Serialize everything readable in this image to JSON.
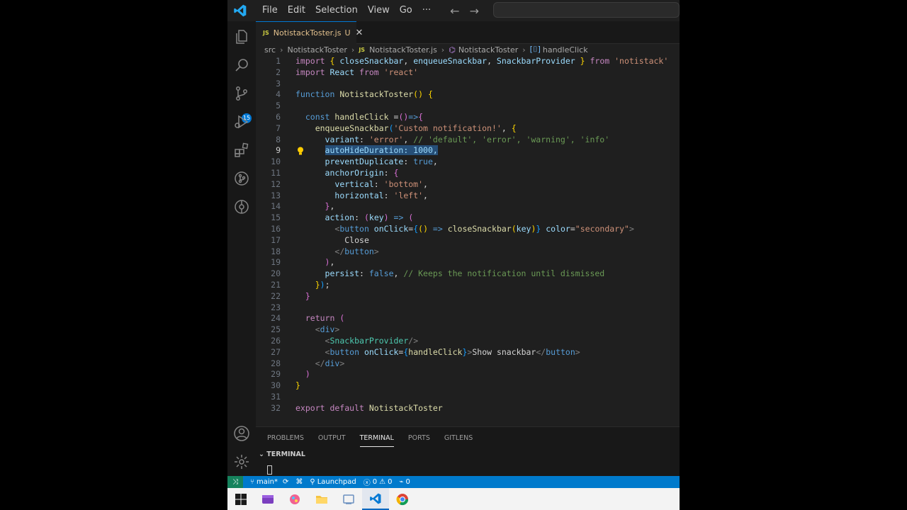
{
  "menu": [
    "File",
    "Edit",
    "Selection",
    "View",
    "Go",
    "···"
  ],
  "tab": {
    "filename": "NotistackToster.js",
    "status": "U",
    "lang_badge": "JS"
  },
  "breadcrumb": [
    "src",
    "NotistackToster",
    "NotistackToster.js",
    "NotistackToster",
    "handleClick"
  ],
  "activity": {
    "scm_badge": "15"
  },
  "editor": {
    "active_line": 9,
    "lines": [
      {
        "n": "1"
      },
      {
        "n": "2"
      },
      {
        "n": "3"
      },
      {
        "n": "4"
      },
      {
        "n": "5"
      },
      {
        "n": "6"
      },
      {
        "n": "7"
      },
      {
        "n": "8"
      },
      {
        "n": "9"
      },
      {
        "n": "10"
      },
      {
        "n": "11"
      },
      {
        "n": "12"
      },
      {
        "n": "13"
      },
      {
        "n": "14"
      },
      {
        "n": "15"
      },
      {
        "n": "16"
      },
      {
        "n": "17"
      },
      {
        "n": "18"
      },
      {
        "n": "19"
      },
      {
        "n": "20"
      },
      {
        "n": "21"
      },
      {
        "n": "22"
      },
      {
        "n": "23"
      },
      {
        "n": "24"
      },
      {
        "n": "25"
      },
      {
        "n": "26"
      },
      {
        "n": "27"
      },
      {
        "n": "28"
      },
      {
        "n": "29"
      },
      {
        "n": "30"
      },
      {
        "n": "31"
      },
      {
        "n": "32"
      }
    ],
    "code": [
      [
        [
          "kw",
          "import "
        ],
        [
          "b1",
          "{ "
        ],
        [
          "var",
          "closeSnackbar"
        ],
        [
          "pl",
          ", "
        ],
        [
          "var",
          "enqueueSnackbar"
        ],
        [
          "pl",
          ", "
        ],
        [
          "var",
          "SnackbarProvider"
        ],
        [
          "b1",
          " } "
        ],
        [
          "kw",
          "from "
        ],
        [
          "str",
          "'notistack'"
        ]
      ],
      [
        [
          "kw",
          "import "
        ],
        [
          "var",
          "React "
        ],
        [
          "kw",
          "from "
        ],
        [
          "str",
          "'react'"
        ]
      ],
      [],
      [
        [
          "kw2",
          "function "
        ],
        [
          "fn",
          "NotistackToster"
        ],
        [
          "b1",
          "() {"
        ]
      ],
      [],
      [
        [
          "pl",
          "  "
        ],
        [
          "kw2",
          "const "
        ],
        [
          "fn",
          "handleClick "
        ],
        [
          "pl",
          "="
        ],
        [
          "b2",
          "()"
        ],
        [
          "kw2",
          "=>"
        ],
        [
          "b2",
          "{"
        ]
      ],
      [
        [
          "pl",
          "    "
        ],
        [
          "fn",
          "enqueueSnackbar"
        ],
        [
          "b3",
          "("
        ],
        [
          "str",
          "'Custom notification!'"
        ],
        [
          "pl",
          ", "
        ],
        [
          "b1",
          "{"
        ]
      ],
      [
        [
          "pl",
          "      "
        ],
        [
          "var",
          "variant"
        ],
        [
          "pl",
          ": "
        ],
        [
          "str",
          "'error'"
        ],
        [
          "pl",
          ", "
        ],
        [
          "cm",
          "// 'default', 'error', 'warning', 'info'"
        ]
      ],
      [
        [
          "pl",
          "      "
        ],
        [
          "sel",
          "autoHideDuration: 1000,"
        ]
      ],
      [
        [
          "pl",
          "      "
        ],
        [
          "var",
          "preventDuplicate"
        ],
        [
          "pl",
          ": "
        ],
        [
          "kw2",
          "true"
        ],
        [
          "pl",
          ","
        ]
      ],
      [
        [
          "pl",
          "      "
        ],
        [
          "var",
          "anchorOrigin"
        ],
        [
          "pl",
          ": "
        ],
        [
          "b2",
          "{"
        ]
      ],
      [
        [
          "pl",
          "        "
        ],
        [
          "var",
          "vertical"
        ],
        [
          "pl",
          ": "
        ],
        [
          "str",
          "'bottom'"
        ],
        [
          "pl",
          ","
        ]
      ],
      [
        [
          "pl",
          "        "
        ],
        [
          "var",
          "horizontal"
        ],
        [
          "pl",
          ": "
        ],
        [
          "str",
          "'left'"
        ],
        [
          "pl",
          ","
        ]
      ],
      [
        [
          "pl",
          "      "
        ],
        [
          "b2",
          "}"
        ],
        [
          "pl",
          ","
        ]
      ],
      [
        [
          "pl",
          "      "
        ],
        [
          "var",
          "action"
        ],
        [
          "pl",
          ": "
        ],
        [
          "b2",
          "("
        ],
        [
          "var",
          "key"
        ],
        [
          "b2",
          ")"
        ],
        [
          "kw2",
          " => "
        ],
        [
          "b2",
          "("
        ]
      ],
      [
        [
          "pl",
          "        "
        ],
        [
          "tag",
          "<"
        ],
        [
          "tn",
          "button "
        ],
        [
          "var",
          "onClick"
        ],
        [
          "pl",
          "="
        ],
        [
          "b3",
          "{"
        ],
        [
          "b1",
          "() "
        ],
        [
          "kw2",
          "=> "
        ],
        [
          "fn",
          "closeSnackbar"
        ],
        [
          "b1",
          "("
        ],
        [
          "var",
          "key"
        ],
        [
          "b1",
          ")"
        ],
        [
          "b3",
          "}"
        ],
        [
          "var",
          " color"
        ],
        [
          "pl",
          "="
        ],
        [
          "str",
          "\"secondary\""
        ],
        [
          "tag",
          ">"
        ]
      ],
      [
        [
          "pl",
          "          "
        ],
        [
          "pl",
          "Close"
        ]
      ],
      [
        [
          "pl",
          "        "
        ],
        [
          "tag",
          "</"
        ],
        [
          "tn",
          "button"
        ],
        [
          "tag",
          ">"
        ]
      ],
      [
        [
          "pl",
          "      "
        ],
        [
          "b2",
          ")"
        ],
        [
          "pl",
          ","
        ]
      ],
      [
        [
          "pl",
          "      "
        ],
        [
          "var",
          "persist"
        ],
        [
          "pl",
          ": "
        ],
        [
          "kw2",
          "false"
        ],
        [
          "pl",
          ", "
        ],
        [
          "cm",
          "// Keeps the notification until dismissed"
        ]
      ],
      [
        [
          "pl",
          "    "
        ],
        [
          "b1",
          "}"
        ],
        [
          "b3",
          ")"
        ],
        [
          "pl",
          ";"
        ]
      ],
      [
        [
          "pl",
          "  "
        ],
        [
          "b2",
          "}"
        ]
      ],
      [],
      [
        [
          "pl",
          "  "
        ],
        [
          "kw",
          "return "
        ],
        [
          "b2",
          "("
        ]
      ],
      [
        [
          "pl",
          "    "
        ],
        [
          "tag",
          "<"
        ],
        [
          "tn",
          "div"
        ],
        [
          "tag",
          ">"
        ]
      ],
      [
        [
          "pl",
          "      "
        ],
        [
          "tag",
          "<"
        ],
        [
          "cls",
          "SnackbarProvider"
        ],
        [
          "tag",
          "/>"
        ]
      ],
      [
        [
          "pl",
          "      "
        ],
        [
          "tag",
          "<"
        ],
        [
          "tn",
          "button "
        ],
        [
          "var",
          "onClick"
        ],
        [
          "pl",
          "="
        ],
        [
          "b3",
          "{"
        ],
        [
          "fn",
          "handleClick"
        ],
        [
          "b3",
          "}"
        ],
        [
          "tag",
          ">"
        ],
        [
          "pl",
          "Show snackbar"
        ],
        [
          "tag",
          "</"
        ],
        [
          "tn",
          "button"
        ],
        [
          "tag",
          ">"
        ]
      ],
      [
        [
          "pl",
          "    "
        ],
        [
          "tag",
          "</"
        ],
        [
          "tn",
          "div"
        ],
        [
          "tag",
          ">"
        ]
      ],
      [
        [
          "pl",
          "  "
        ],
        [
          "b2",
          ")"
        ]
      ],
      [
        [
          "b1",
          "}"
        ]
      ],
      [],
      [
        [
          "kw",
          "export default "
        ],
        [
          "fn",
          "NotistackToster"
        ]
      ]
    ]
  },
  "panel": {
    "tabs": [
      "PROBLEMS",
      "OUTPUT",
      "TERMINAL",
      "PORTS",
      "GITLENS"
    ],
    "active_tab": "TERMINAL",
    "section_title": "TERMINAL"
  },
  "statusbar": {
    "branch": "main*",
    "launchpad": "Launchpad",
    "errors": "0",
    "warnings": "0",
    "ports": "0"
  },
  "colors": {
    "accent": "#007acc",
    "editor_bg": "#1f1f1f"
  }
}
